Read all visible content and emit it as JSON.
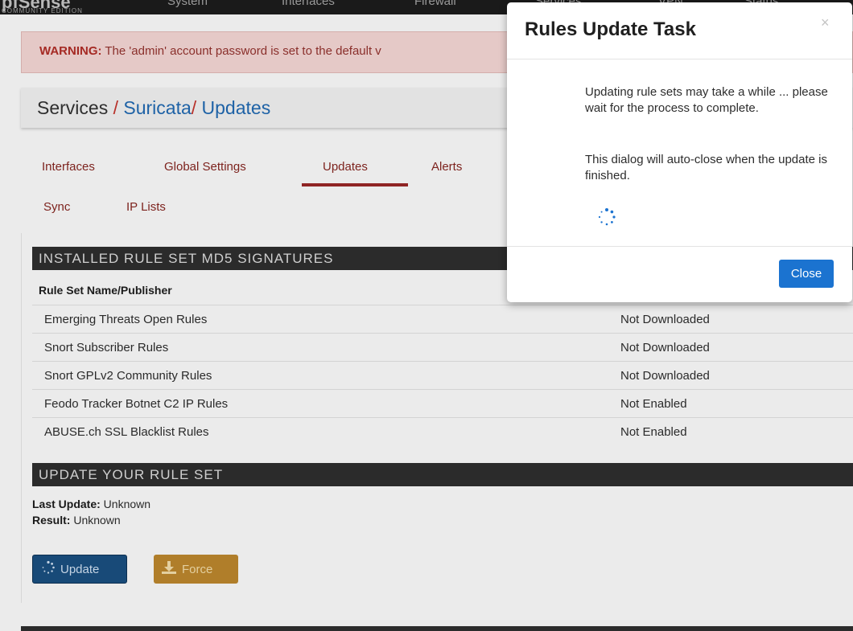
{
  "colors": {
    "brand_red": "#8f2424",
    "link_blue": "#1e62a6",
    "primary": "#1b73d0",
    "warning": "#b07e2a"
  },
  "navbar": {
    "logo": "pfSense",
    "edition": "COMMUNITY EDITION",
    "items": [
      "System",
      "Interfaces",
      "Firewall",
      "Services",
      "VPN",
      "Status"
    ]
  },
  "warning": {
    "label": "WARNING:",
    "text": " The 'admin' account password is set to the default v"
  },
  "breadcrumb": {
    "root": "Services",
    "sep": "/",
    "crumb1": "Suricata",
    "crumb2": "Updates"
  },
  "tabs": [
    {
      "label": "Interfaces"
    },
    {
      "label": "Global Settings"
    },
    {
      "label": "Updates",
      "active": true
    },
    {
      "label": "Alerts"
    },
    {
      "label": "Sync"
    },
    {
      "label": "IP Lists"
    }
  ],
  "signatures": {
    "heading": "INSTALLED RULE SET MD5 SIGNATURES",
    "column": "Rule Set Name/Publisher",
    "rows": [
      {
        "name": "Emerging Threats Open Rules",
        "status": "Not Downloaded"
      },
      {
        "name": "Snort Subscriber Rules",
        "status": "Not Downloaded"
      },
      {
        "name": "Snort GPLv2 Community Rules",
        "status": "Not Downloaded"
      },
      {
        "name": "Feodo Tracker Botnet C2 IP Rules",
        "status": "Not Enabled"
      },
      {
        "name": "ABUSE.ch SSL Blacklist Rules",
        "status": "Not Enabled"
      }
    ]
  },
  "update": {
    "heading": "UPDATE YOUR RULE SET",
    "last_label": "Last Update:",
    "last_value": " Unknown",
    "result_label": "Result:",
    "result_value": " Unknown",
    "update_btn": "Update",
    "force_btn": "Force",
    "update_icon": "spinner-icon",
    "force_icon": "download-icon"
  },
  "modal": {
    "title": "Rules Update Task",
    "close_glyph": "×",
    "p1": "Updating rule sets may take a while ... please wait for the process to complete.",
    "p2": "This dialog will auto-close when the update is finished.",
    "button": "Close",
    "spinner_icon": "spinner-icon"
  }
}
